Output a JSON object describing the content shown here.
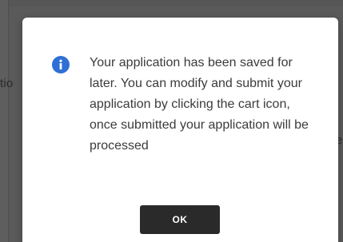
{
  "background": {
    "left_fragment": "tio",
    "right_fragment": "e"
  },
  "dialog": {
    "icon": "info-icon",
    "message": "Your application has been saved for later. You can modify and submit your application by clicking the cart icon, once submitted your application will be processed",
    "ok_label": "OK"
  },
  "colors": {
    "icon": "#2f6fd6",
    "button": "#2a2a2a",
    "overlay": "#5a5a5a"
  }
}
